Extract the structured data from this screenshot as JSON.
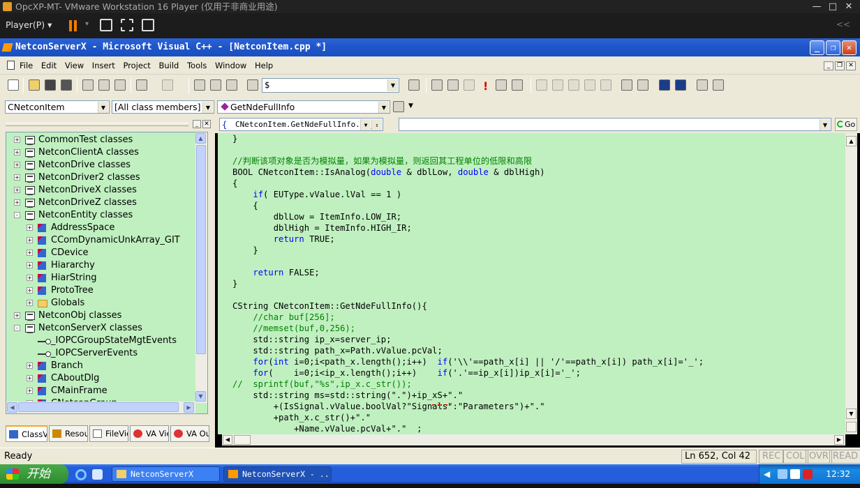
{
  "vm": {
    "title": "OpcXP-MT- VMware Workstation 16 Player (仅用于非商业用途)",
    "player_menu": "Player(P)",
    "win_controls": [
      "—",
      "□",
      "✕"
    ],
    "collapse_glyph": "<<",
    "accent_color": "#f57c00"
  },
  "app": {
    "title": "NetconServerX - Microsoft Visual C++ - [NetconItem.cpp *]",
    "controls": [
      "_",
      "❐",
      "✕"
    ]
  },
  "menu": {
    "items": [
      "File",
      "Edit",
      "View",
      "Insert",
      "Project",
      "Build",
      "Tools",
      "Window",
      "Help"
    ],
    "mdi_controls": [
      "_",
      "❐",
      "✕"
    ]
  },
  "toolbar": {
    "find_value": "$"
  },
  "wizard_bar": {
    "class_combo": "CNetconItem",
    "filter_combo": "[All class members]",
    "member_combo": "GetNdeFullInfo"
  },
  "va_bar": {
    "context_combo": "CNetconItem.GetNdeFullInfo.ip_x",
    "go_label": "Go"
  },
  "tree": {
    "items": [
      {
        "label": "CommonTest classes",
        "level": 0,
        "expander": "+",
        "icon": "class-folder-icon"
      },
      {
        "label": "NetconClientA classes",
        "level": 0,
        "expander": "+",
        "icon": "class-folder-icon"
      },
      {
        "label": "NetconDrive classes",
        "level": 0,
        "expander": "+",
        "icon": "class-folder-icon"
      },
      {
        "label": "NetconDriver2 classes",
        "level": 0,
        "expander": "+",
        "icon": "class-folder-icon"
      },
      {
        "label": "NetconDriveX classes",
        "level": 0,
        "expander": "+",
        "icon": "class-folder-icon"
      },
      {
        "label": "NetconDriveZ classes",
        "level": 0,
        "expander": "+",
        "icon": "class-folder-icon"
      },
      {
        "label": "NetconEntity classes",
        "level": 0,
        "expander": "-",
        "icon": "class-folder-icon"
      },
      {
        "label": "AddressSpace",
        "level": 1,
        "expander": "+",
        "icon": "class-icon"
      },
      {
        "label": "CComDynamicUnkArray_GIT",
        "level": 1,
        "expander": "+",
        "icon": "class-icon"
      },
      {
        "label": "CDevice",
        "level": 1,
        "expander": "+",
        "icon": "class-icon"
      },
      {
        "label": "Hiararchy",
        "level": 1,
        "expander": "+",
        "icon": "class-icon"
      },
      {
        "label": "HiarString",
        "level": 1,
        "expander": "+",
        "icon": "class-icon"
      },
      {
        "label": "ProtoTree",
        "level": 1,
        "expander": "+",
        "icon": "class-icon"
      },
      {
        "label": "Globals",
        "level": 1,
        "expander": "+",
        "icon": "folder-icon"
      },
      {
        "label": "NetconObj classes",
        "level": 0,
        "expander": "+",
        "icon": "class-folder-icon"
      },
      {
        "label": "NetconServerX classes",
        "level": 0,
        "expander": "-",
        "icon": "class-folder-icon"
      },
      {
        "label": "_IOPCGroupStateMgtEvents",
        "level": 1,
        "expander": "",
        "icon": "interface-icon"
      },
      {
        "label": "_IOPCServerEvents",
        "level": 1,
        "expander": "",
        "icon": "interface-icon"
      },
      {
        "label": "Branch",
        "level": 1,
        "expander": "+",
        "icon": "class-icon"
      },
      {
        "label": "CAboutDlg",
        "level": 1,
        "expander": "+",
        "icon": "class-icon"
      },
      {
        "label": "CMainFrame",
        "level": 1,
        "expander": "+",
        "icon": "class-icon"
      },
      {
        "label": "CNetconGroup",
        "level": 1,
        "expander": "+",
        "icon": "class-icon"
      }
    ]
  },
  "tabs": [
    "ClassView",
    "ResourceView",
    "FileView",
    "VA View",
    "VA Outline"
  ],
  "code_lines": [
    [
      {
        "t": "}",
        "c": ""
      }
    ],
    [
      {
        "t": "",
        "c": ""
      }
    ],
    [
      {
        "t": "//判断该项对象是否为模拟量，如果为模拟量，则返回其工程单位的低限和高限",
        "c": "cm"
      }
    ],
    [
      {
        "t": "BOOL CNetconItem::IsAnalog(",
        "c": ""
      },
      {
        "t": "double",
        "c": "kw"
      },
      {
        "t": " & dblLow, ",
        "c": ""
      },
      {
        "t": "double",
        "c": "kw"
      },
      {
        "t": " & dblHigh)",
        "c": ""
      }
    ],
    [
      {
        "t": "{",
        "c": ""
      }
    ],
    [
      {
        "t": "    ",
        "c": ""
      },
      {
        "t": "if",
        "c": "kw"
      },
      {
        "t": "( EUType.vValue.lVal == 1 )",
        "c": ""
      }
    ],
    [
      {
        "t": "    {",
        "c": ""
      }
    ],
    [
      {
        "t": "        dblLow = ItemInfo.LOW_IR;",
        "c": ""
      }
    ],
    [
      {
        "t": "        dblHigh = ItemInfo.HIGH_IR;",
        "c": ""
      }
    ],
    [
      {
        "t": "        ",
        "c": ""
      },
      {
        "t": "return",
        "c": "kw"
      },
      {
        "t": " TRUE;",
        "c": ""
      }
    ],
    [
      {
        "t": "    }",
        "c": ""
      }
    ],
    [
      {
        "t": "",
        "c": ""
      }
    ],
    [
      {
        "t": "    ",
        "c": ""
      },
      {
        "t": "return",
        "c": "kw"
      },
      {
        "t": " FALSE;",
        "c": ""
      }
    ],
    [
      {
        "t": "}",
        "c": ""
      }
    ],
    [
      {
        "t": "",
        "c": ""
      }
    ],
    [
      {
        "t": "CString CNetconItem::GetNdeFullInfo(){",
        "c": ""
      }
    ],
    [
      {
        "t": "    //char buf[256];",
        "c": "cm"
      }
    ],
    [
      {
        "t": "    //memset(buf,0,256);",
        "c": "cm"
      }
    ],
    [
      {
        "t": "    std::string ip_x=server_ip;",
        "c": ""
      }
    ],
    [
      {
        "t": "    std::string path_x=Path.vValue.pcVal;",
        "c": ""
      }
    ],
    [
      {
        "t": "    ",
        "c": ""
      },
      {
        "t": "for",
        "c": "kw"
      },
      {
        "t": "(",
        "c": ""
      },
      {
        "t": "int",
        "c": "kw"
      },
      {
        "t": " i=0;i<path_x.length();i++)  ",
        "c": ""
      },
      {
        "t": "if",
        "c": "kw"
      },
      {
        "t": "('\\\\'==path_x[i] || '/'==path_x[i]) path_x[i]='_';",
        "c": ""
      }
    ],
    [
      {
        "t": "    ",
        "c": ""
      },
      {
        "t": "for",
        "c": "kw"
      },
      {
        "t": "(    i=0;i<ip_x.length();i++)    ",
        "c": ""
      },
      {
        "t": "if",
        "c": "kw"
      },
      {
        "t": "('.'==ip_x[i])ip_x[i]='_';",
        "c": ""
      }
    ],
    [
      {
        "t": "//  sprintf(buf,\"%s\",ip_x.c_str());",
        "c": "cm"
      }
    ],
    [
      {
        "t": "    std::string ms=std::string(\".\")+ip_xS+\".\"",
        "c": ""
      }
    ],
    [
      {
        "t": "        +(IsSignal.vValue.boolVal?\"Signals\":\"Parameters\")+\".\"",
        "c": ""
      }
    ],
    [
      {
        "t": "        +path_x.c_str()+\".\"",
        "c": ""
      }
    ],
    [
      {
        "t": "            +Name.vValue.pcVal+\".\"  ;",
        "c": ""
      }
    ]
  ],
  "status": {
    "ready": "Ready",
    "position": "Ln 652, Col 42",
    "indicators": [
      "REC",
      "COL",
      "OVR",
      "READ"
    ]
  },
  "taskbar": {
    "start_label": "开始",
    "tasks": [
      "NetconServerX",
      "NetconServerX - ..."
    ],
    "clock": "12:32"
  }
}
